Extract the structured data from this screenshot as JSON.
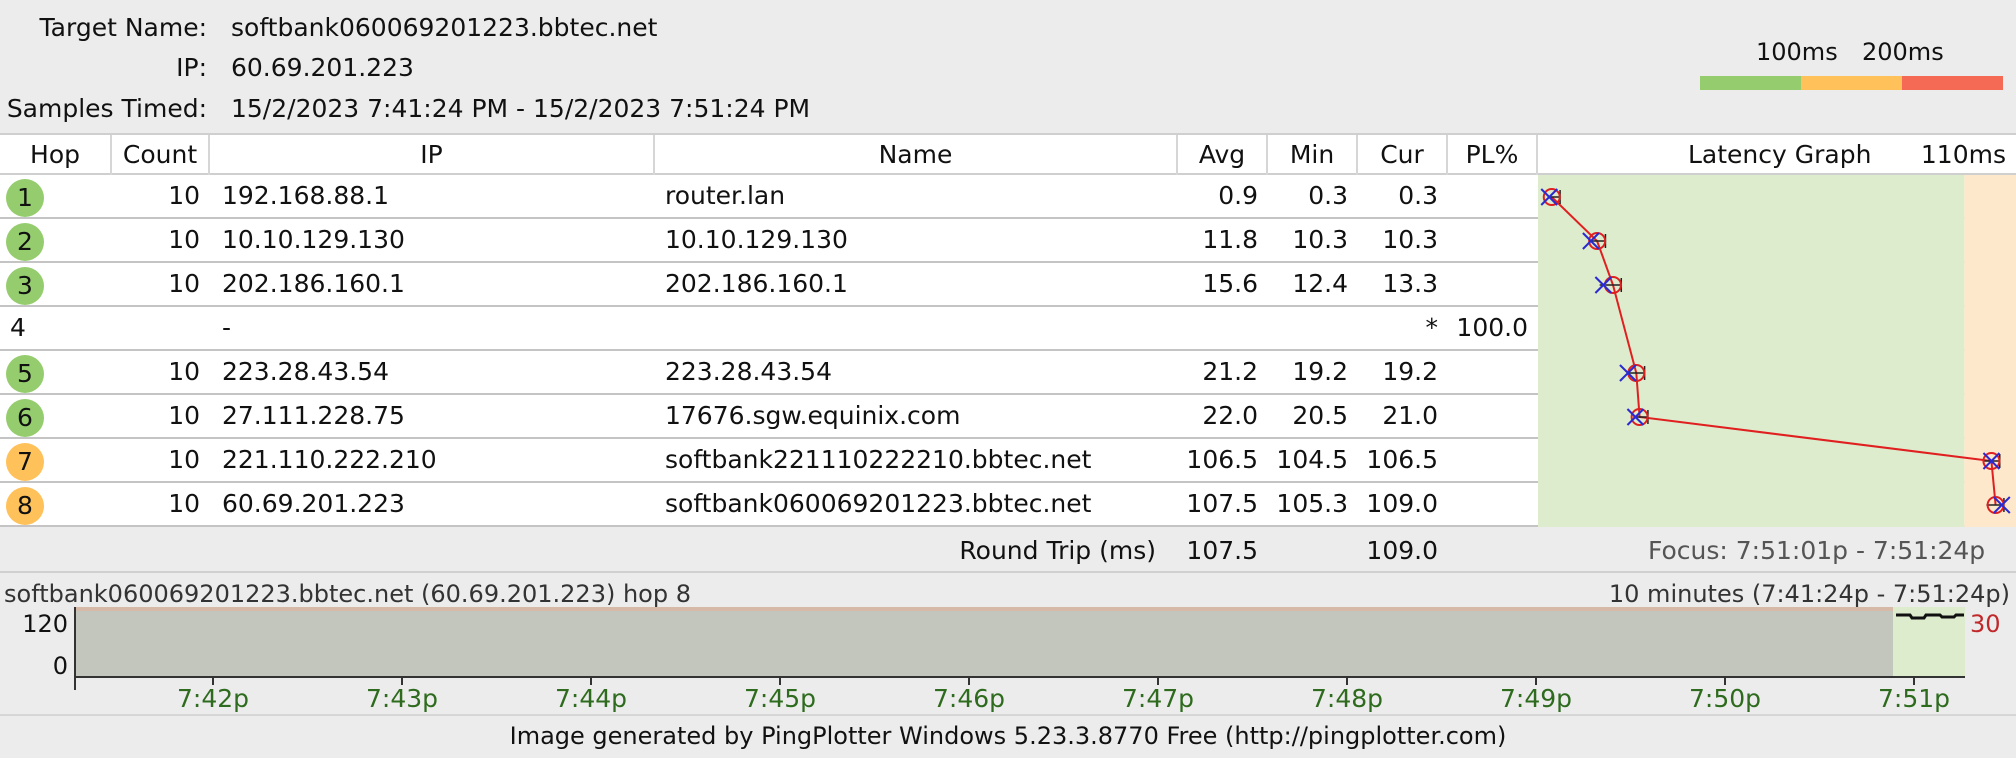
{
  "target": {
    "name_label": "Target Name:",
    "name_value": "softbank060069201223.bbtec.net",
    "ip_label": "IP:",
    "ip_value": "60.69.201.223",
    "samples_label": "Samples Timed:",
    "samples_value": "15/2/2023 7:41:24 PM - 15/2/2023 7:51:24 PM"
  },
  "scale": {
    "label_100": "100ms",
    "label_200": "200ms",
    "colors": {
      "good": "#95cd6e",
      "warn": "#ffc15a",
      "bad": "#f56a54"
    }
  },
  "table": {
    "columns": {
      "hop": "Hop",
      "count": "Count",
      "ip": "IP",
      "name": "Name",
      "avg": "Avg",
      "min": "Min",
      "cur": "Cur",
      "pl": "PL%",
      "graph": "Latency Graph",
      "graph_max": "110ms"
    },
    "rows": [
      {
        "hop": "1",
        "count": "10",
        "ip": "192.168.88.1",
        "name": "router.lan",
        "avg": "0.9",
        "min": "0.3",
        "cur": "0.3",
        "pl": "",
        "status": "good",
        "avg_ms": 0.9,
        "min_ms": 0.3,
        "cur_ms": 0.3
      },
      {
        "hop": "2",
        "count": "10",
        "ip": "10.10.129.130",
        "name": "10.10.129.130",
        "avg": "11.8",
        "min": "10.3",
        "cur": "10.3",
        "pl": "",
        "status": "good",
        "avg_ms": 11.8,
        "min_ms": 10.3,
        "cur_ms": 10.3
      },
      {
        "hop": "3",
        "count": "10",
        "ip": "202.186.160.1",
        "name": "202.186.160.1",
        "avg": "15.6",
        "min": "12.4",
        "cur": "13.3",
        "pl": "",
        "status": "good",
        "avg_ms": 15.6,
        "min_ms": 12.4,
        "cur_ms": 13.3
      },
      {
        "hop": "4",
        "count": "",
        "ip": "-",
        "name": "",
        "avg": "",
        "min": "",
        "cur": "*",
        "pl": "100.0",
        "status": "none"
      },
      {
        "hop": "5",
        "count": "10",
        "ip": "223.28.43.54",
        "name": "223.28.43.54",
        "avg": "21.2",
        "min": "19.2",
        "cur": "19.2",
        "pl": "",
        "status": "good",
        "avg_ms": 21.2,
        "min_ms": 19.2,
        "cur_ms": 19.2
      },
      {
        "hop": "6",
        "count": "10",
        "ip": "27.111.228.75",
        "name": "17676.sgw.equinix.com",
        "avg": "22.0",
        "min": "20.5",
        "cur": "21.0",
        "pl": "",
        "status": "good",
        "avg_ms": 22.0,
        "min_ms": 20.5,
        "cur_ms": 21.0
      },
      {
        "hop": "7",
        "count": "10",
        "ip": "221.110.222.210",
        "name": "softbank221110222210.bbtec.net",
        "avg": "106.5",
        "min": "104.5",
        "cur": "106.5",
        "pl": "",
        "status": "warn",
        "avg_ms": 106.5,
        "min_ms": 104.5,
        "cur_ms": 106.5
      },
      {
        "hop": "8",
        "count": "10",
        "ip": "60.69.201.223",
        "name": "softbank060069201223.bbtec.net",
        "avg": "107.5",
        "min": "105.3",
        "cur": "109.0",
        "pl": "",
        "status": "warn",
        "avg_ms": 107.5,
        "min_ms": 105.3,
        "cur_ms": 109.0
      }
    ],
    "footer": {
      "round_trip_label": "Round Trip (ms)",
      "avg": "107.5",
      "cur": "109.0",
      "focus": "Focus: 7:51:01p - 7:51:24p"
    }
  },
  "timeline": {
    "title": "softbank060069201223.bbtec.net (60.69.201.223) hop 8",
    "range": "10 minutes (7:41:24p - 7:51:24p)",
    "y_top": "120",
    "y_bottom": "0",
    "right_label": "30",
    "ticks": [
      "7:42p",
      "7:43p",
      "7:44p",
      "7:45p",
      "7:46p",
      "7:47p",
      "7:48p",
      "7:49p",
      "7:50p",
      "7:51p"
    ]
  },
  "footer": {
    "generated": "Image generated by PingPlotter Windows 5.23.3.8770 Free (http://pingplotter.com)"
  }
}
